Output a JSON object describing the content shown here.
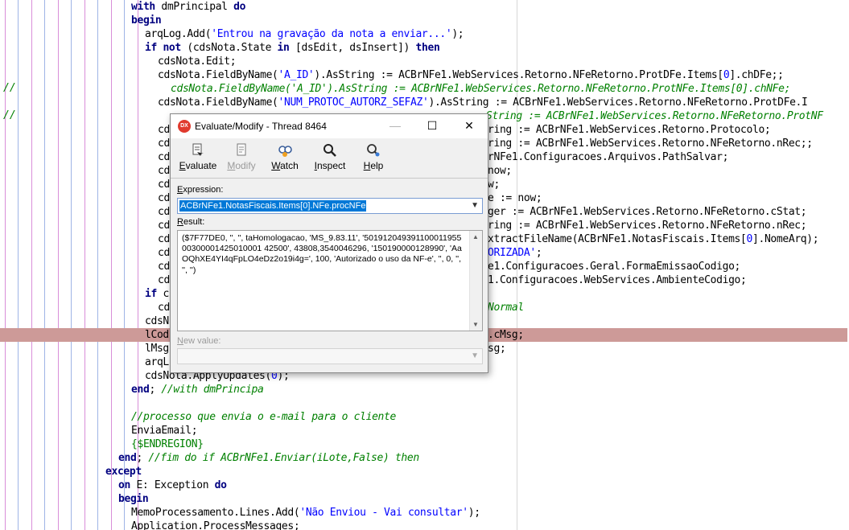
{
  "editor": {
    "slashes_1": "//",
    "slashes_2": "//",
    "lines": {
      "l0": {
        "kw1": "with",
        "t1": " dmPrincipal ",
        "kw2": "do"
      },
      "l1": {
        "kw1": "begin"
      },
      "l2": {
        "t1": "arqLog.Add(",
        "s1": "'Entrou na gravação da nota a enviar...'",
        "t2": ");"
      },
      "l3": {
        "kw1": "if",
        "t1": " ",
        "kw2": "not",
        "t2": " (cdsNota.State ",
        "kw3": "in",
        "t3": " [dsEdit, dsInsert]) ",
        "kw4": "then"
      },
      "l4": {
        "t1": "cdsNota.Edit;"
      },
      "l5": {
        "t1": "cdsNota.FieldByName(",
        "s1": "'A_ID'",
        "t2": ").AsString := ACBrNFe1.WebServices.Retorno.NFeRetorno.ProtDFe.Items[",
        "n1": "0",
        "t3": "].chDFe;;"
      },
      "l6": {
        "c1": "cdsNota.FieldByName('A_ID').AsString := ACBrNFe1.WebServices.Retorno.NFeRetorno.ProtNFe.Items[0].chNFe;"
      },
      "l7": {
        "t1": "cdsNota.FieldByName(",
        "s1": "'NUM_PROTOC_AUTORZ_SEFAZ'",
        "t2": ").AsString := ACBrNFe1.WebServices.Retorno.NFeRetorno.ProtDFe.I"
      },
      "l8": {
        "c1": "String := ACBrNFe1.WebServices.Retorno.NFeRetorno.ProtNF"
      },
      "l9": {
        "t0": "cd",
        "t1": "ring := ACBrNFe1.WebServices.Retorno.Protocolo;"
      },
      "l10": {
        "t0": "cd",
        "t1": "ring := ACBrNFe1.WebServices.Retorno.NFeRetorno.nRec;;"
      },
      "l11": {
        "t0": "cd",
        "t1": "rNFe1.Configuracoes.Arquivos.PathSalvar;"
      },
      "l12": {
        "t0": "cd",
        "t1": "now;"
      },
      "l13": {
        "t0": "cd",
        "t1": "w;"
      },
      "l14": {
        "t0": "cd",
        "t1": "e := now;"
      },
      "l15": {
        "t0": "cd",
        "t1": "ger := ACBrNFe1.WebServices.Retorno.NFeRetorno.cStat;"
      },
      "l16": {
        "t0": "cd",
        "t1": "ring := ACBrNFe1.WebServices.Retorno.NFeRetorno.nRec;"
      },
      "l17": {
        "t0": "cd",
        "t1": "xtractFileName(ACBrNFe1.NotasFiscais.Items[",
        "n1": "0",
        "t2": "].NomeArq);"
      },
      "l18": {
        "t0": "cd",
        "s1": "ORIZADA'",
        "t1": ";"
      },
      "l19": {
        "t0": "cd",
        "t1": "e1.Configuracoes.Geral.FormaEmissaoCodigo;"
      },
      "l20": {
        "t0": "cd",
        "t1": "1.Configuracoes.WebServices.AmbienteCodigo;"
      },
      "l21": {
        "kw1": "if",
        "t1": " c"
      },
      "l21b": {
        "c1": "Normal"
      },
      "l22": {
        "t0": "cd"
      },
      "l23": {
        "t0": "cdsN"
      },
      "l24": {
        "t0": "lCod",
        "t1": ".cMsg;"
      },
      "l25": {
        "t0": "lMsg",
        "t1": "sg;"
      },
      "l26": {
        "t0": "arqL"
      },
      "l27": {
        "t1": "cdsNota.ApplyUpdates(",
        "n1": "0",
        "t2": ");"
      },
      "l28": {
        "kw1": "end",
        "t1": "; ",
        "c1": "//with dmPrincipa"
      },
      "l30": {
        "c1": "//processo que envia o e-mail para o cliente"
      },
      "l31": {
        "t1": "EnviaEmail;"
      },
      "l32": {
        "d1": "{$ENDREGION}"
      },
      "l33": {
        "kw1": "end",
        "t1": "; ",
        "c1": "//fim do if ACBrNFe1.Enviar(iLote,False) then"
      },
      "l34": {
        "kw1": "except"
      },
      "l35": {
        "kw1": "on",
        "t1": " E: Exception ",
        "kw2": "do"
      },
      "l36": {
        "kw1": "begin"
      },
      "l37": {
        "t1": "MemoProcessamento.Lines.Add(",
        "s1": "'Não Enviou - Vai consultar'",
        "t2": ");"
      },
      "l38": {
        "t1": "Application.ProcessMessages;"
      }
    }
  },
  "dialog": {
    "logo_text": "DX",
    "title": "Evaluate/Modify - Thread 8464",
    "minimize": "—",
    "maximize": "☐",
    "close": "✕",
    "toolbar": {
      "evaluate": {
        "first": "E",
        "rest": "valuate",
        "icon": "evaluate-icon"
      },
      "modify": {
        "first": "M",
        "rest": "odify",
        "icon": "modify-icon"
      },
      "watch": {
        "first": "W",
        "rest": "atch",
        "icon": "watch-icon"
      },
      "inspect": {
        "first": "I",
        "rest": "nspect",
        "icon": "inspect-icon"
      },
      "help": {
        "first": "H",
        "rest": "elp",
        "icon": "help-icon"
      }
    },
    "expression_label": {
      "first": "E",
      "rest": "xpression:"
    },
    "expression_value": "ACBrNFe1.NotasFiscais.Items[0].NFe.procNFe",
    "result_label": {
      "first": "R",
      "rest": "esult:"
    },
    "result_value": "($7F77DE0, '', '', taHomologacao, 'MS_9.83.11', '50191204939110001195500300001425010001 42500', 43808,3540046296, '150190000128990', 'AaOQhXE4YI4qFpLO4eDz2o19i4g=', 100, 'Autorizado o uso da NF-e', '', 0, '', '', '')",
    "new_value_label": {
      "first": "N",
      "rest": "ew value:"
    },
    "new_value": ""
  }
}
